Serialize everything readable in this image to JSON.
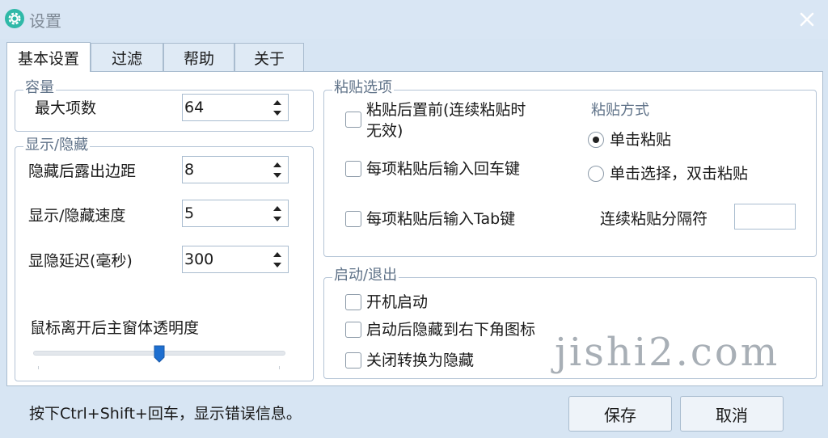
{
  "window": {
    "title": "设置",
    "app_icon": "gear-icon",
    "close_icon": "close-icon"
  },
  "tabs": [
    {
      "label": "基本设置",
      "active": true
    },
    {
      "label": "过滤",
      "active": false
    },
    {
      "label": "帮助",
      "active": false
    },
    {
      "label": "关于",
      "active": false
    }
  ],
  "capacity": {
    "title": "容量",
    "max_items_label": "最大项数",
    "max_items_value": "64"
  },
  "display": {
    "title": "显示/隐藏",
    "edge_label": "隐藏后露出边距",
    "edge_value": "8",
    "speed_label": "显示/隐藏速度",
    "speed_value": "5",
    "delay_label": "显隐延迟(毫秒)",
    "delay_value": "300",
    "opacity_label": "鼠标离开后主窗体透明度",
    "opacity_level": 0.5
  },
  "paste": {
    "title": "粘贴选项",
    "front_line1": "粘贴后置前(连续粘贴时",
    "front_line2": "无效)",
    "front_checked": false,
    "enter_label": "每项粘贴后输入回车键",
    "enter_checked": false,
    "tab_label": "每项粘贴后输入Tab键",
    "tab_checked": false,
    "method_title": "粘贴方式",
    "single_click_label": "单击粘贴",
    "single_click_selected": true,
    "double_click_label": "单击选择，双击粘贴",
    "double_click_selected": false,
    "separator_label": "连续粘贴分隔符",
    "separator_value": ""
  },
  "startup": {
    "title": "启动/退出",
    "autostart_label": "开机启动",
    "autostart_checked": false,
    "hide_tray_label": "启动后隐藏到右下角图标",
    "hide_tray_checked": false,
    "close_hide_label": "关闭转换为隐藏",
    "close_hide_checked": false
  },
  "footer": {
    "hint": "按下Ctrl+Shift+回车，显示错误信息。",
    "save_label": "保存",
    "cancel_label": "取消"
  },
  "watermark": "jishi2.com",
  "colors": {
    "accent": "#2fb9a8",
    "slider_thumb": "#1e6fd0",
    "window_bg": "#d7e5f3"
  }
}
